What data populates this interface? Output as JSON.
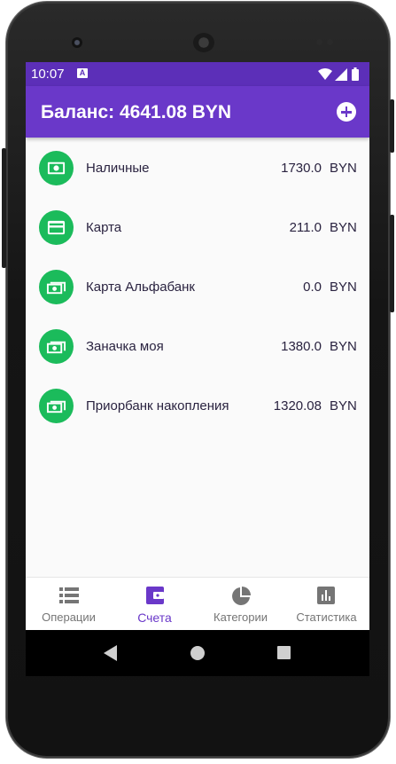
{
  "status_bar": {
    "time": "10:07",
    "notification_badge": "A",
    "icons": [
      "wifi-icon",
      "signal-icon",
      "battery-icon"
    ]
  },
  "app_bar": {
    "title": "Баланс: 4641.08 BYN",
    "add_icon": "add-circle-icon"
  },
  "accounts": [
    {
      "name": "Наличные",
      "amount": "1730.0",
      "currency": "BYN",
      "icon": "cash-icon"
    },
    {
      "name": "Карта",
      "amount": "211.0",
      "currency": "BYN",
      "icon": "card-icon"
    },
    {
      "name": "Карта Альфабанк",
      "amount": "0.0",
      "currency": "BYN",
      "icon": "money-stack-icon"
    },
    {
      "name": "Заначка моя",
      "amount": "1380.0",
      "currency": "BYN",
      "icon": "money-stack-icon"
    },
    {
      "name": "Приорбанк накопления",
      "amount": "1320.08",
      "currency": "BYN",
      "icon": "money-stack-icon"
    }
  ],
  "bottom_nav": [
    {
      "label": "Операции",
      "icon": "list-icon",
      "active": false
    },
    {
      "label": "Счета",
      "icon": "wallet-icon",
      "active": true
    },
    {
      "label": "Категории",
      "icon": "pie-chart-icon",
      "active": false
    },
    {
      "label": "Статистика",
      "icon": "bar-chart-icon",
      "active": false
    }
  ],
  "colors": {
    "status_bar": "#5c2fb8",
    "app_bar": "#6a38c9",
    "accent": "#6a38c9",
    "account_icon_bg": "#1bbb5b",
    "nav_inactive": "#757575"
  }
}
